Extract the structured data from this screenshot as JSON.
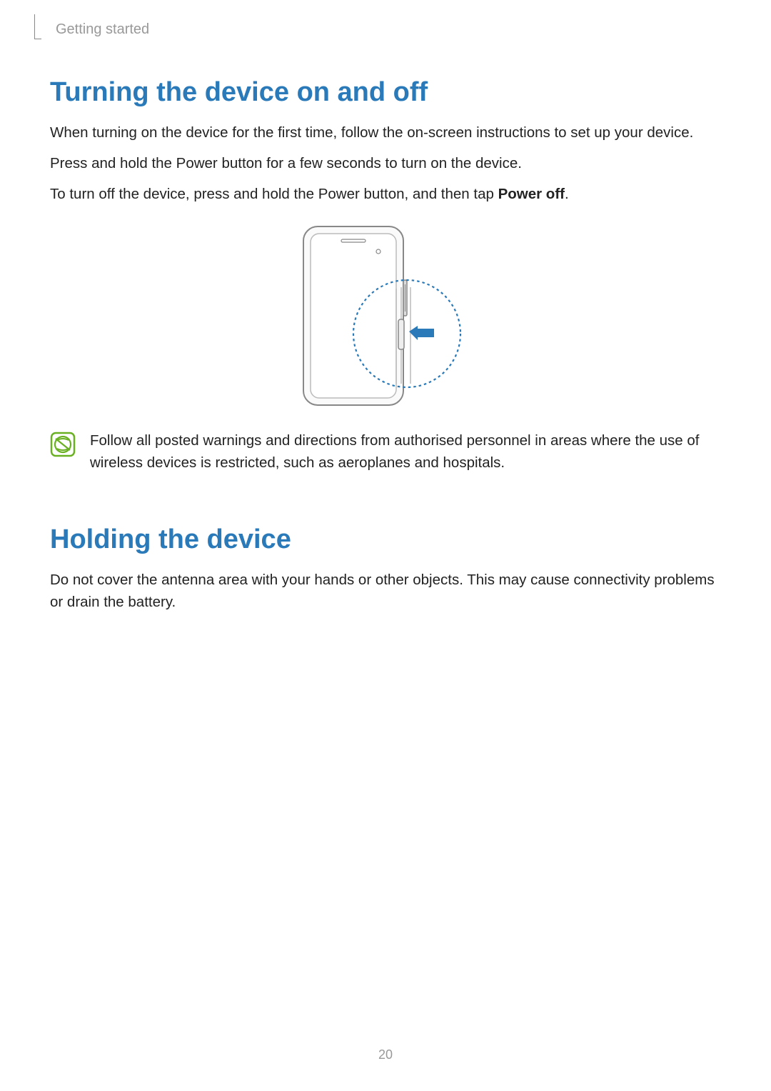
{
  "breadcrumb": "Getting started",
  "section1": {
    "title": "Turning the device on and off",
    "para1": "When turning on the device for the first time, follow the on-screen instructions to set up your device.",
    "para2": "Press and hold the Power button for a few seconds to turn on the device.",
    "para3_prefix": "To turn off the device, press and hold the Power button, and then tap ",
    "para3_bold": "Power off",
    "para3_suffix": "."
  },
  "note": {
    "text": "Follow all posted warnings and directions from authorised personnel in areas where the use of wireless devices is restricted, such as aeroplanes and hospitals."
  },
  "section2": {
    "title": "Holding the device",
    "para1": "Do not cover the antenna area with your hands or other objects. This may cause connectivity problems or drain the battery."
  },
  "page_number": "20"
}
